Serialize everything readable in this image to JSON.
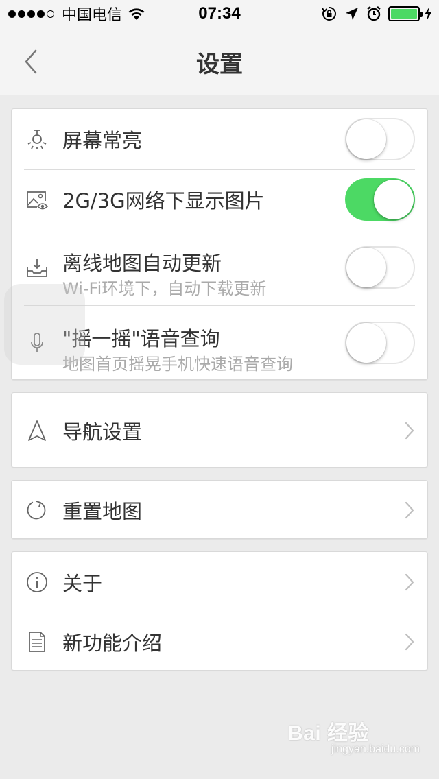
{
  "status_bar": {
    "carrier": "中国电信",
    "time": "07:34",
    "signal_bars_filled": 4,
    "signal_bars_total": 5,
    "battery_level": 1.0,
    "icons": [
      "wifi-icon",
      "rotation-lock-icon",
      "location-arrow-icon",
      "alarm-icon",
      "battery-icon",
      "charging-icon"
    ]
  },
  "nav": {
    "title": "设置",
    "back_icon": "chevron-left-icon"
  },
  "sections": {
    "display": {
      "items": [
        {
          "label": "屏幕常亮",
          "icon": "bulb-icon",
          "toggle_on": false
        },
        {
          "label": "2G/3G网络下显示图片",
          "icon": "image-eye-icon",
          "toggle_on": true
        },
        {
          "label": "离线地图自动更新",
          "sublabel": "Wi-Fi环境下，自动下载更新",
          "icon": "download-tray-icon",
          "toggle_on": false
        },
        {
          "label": "\"摇一摇\"语音查询",
          "sublabel": "地图首页摇晃手机快速语音查询",
          "icon": "microphone-icon",
          "toggle_on": false
        }
      ]
    },
    "navigation": {
      "label": "导航设置",
      "icon": "navigation-arrow-icon"
    },
    "reset": {
      "label": "重置地图",
      "icon": "reset-icon"
    },
    "about": {
      "items": [
        {
          "label": "关于",
          "icon": "info-icon"
        },
        {
          "label": "新功能介绍",
          "icon": "document-icon"
        }
      ]
    }
  },
  "colors": {
    "toggle_on": "#4cd964",
    "background": "#ebebeb",
    "bar_background": "#f4f4f4"
  },
  "watermark": {
    "main": "Bai 经验",
    "sub": "jingyan.baidu.com"
  }
}
